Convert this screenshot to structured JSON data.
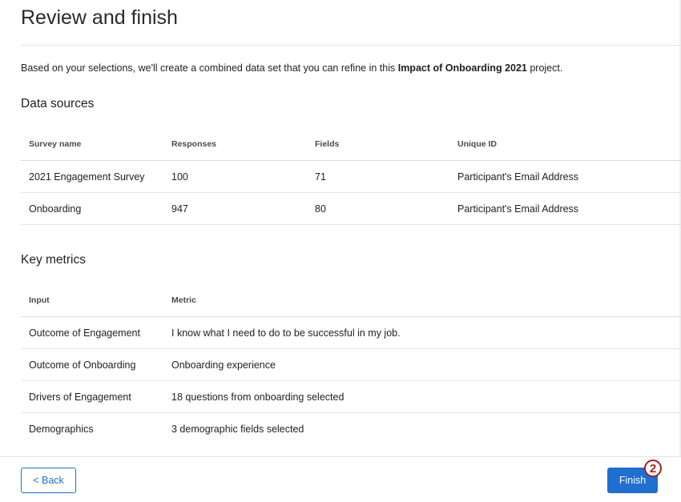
{
  "page": {
    "title": "Review and finish",
    "intro_prefix": "Based on your selections, we'll create a combined data set that you can refine in this ",
    "intro_project": "Impact of Onboarding 2021",
    "intro_suffix": " project."
  },
  "data_sources": {
    "title": "Data sources",
    "columns": [
      "Survey name",
      "Responses",
      "Fields",
      "Unique ID"
    ],
    "rows": [
      {
        "survey_name": "2021 Engagement Survey",
        "responses": "100",
        "fields": "71",
        "unique_id": "Participant's Email Address"
      },
      {
        "survey_name": "Onboarding",
        "responses": "947",
        "fields": "80",
        "unique_id": "Participant's Email Address"
      }
    ]
  },
  "key_metrics": {
    "title": "Key metrics",
    "columns": [
      "Input",
      "Metric"
    ],
    "rows": [
      {
        "input": "Outcome of Engagement",
        "metric": "I know what I need to do to be successful in my job."
      },
      {
        "input": "Outcome of Onboarding",
        "metric": "Onboarding experience"
      },
      {
        "input": "Drivers of Engagement",
        "metric": "18 questions from onboarding selected"
      },
      {
        "input": "Demographics",
        "metric": "3 demographic fields selected"
      }
    ]
  },
  "footer": {
    "back_label": "< Back",
    "finish_label": "Finish",
    "step_marker": "2"
  },
  "colors": {
    "accent": "#1f6fd1",
    "marker": "#a32020"
  }
}
